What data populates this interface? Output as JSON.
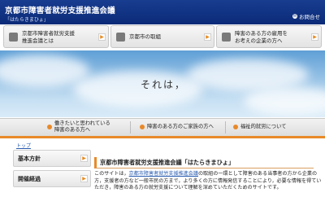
{
  "header": {
    "title": "京都市障害者就労支援推進会議",
    "subtitle": "「はたらきまひょ」",
    "contact": "お問合せ"
  },
  "topnav": [
    {
      "line1": "京都市障害者就労支援",
      "line2": "推進会議とは"
    },
    {
      "line1": "京都市の取組",
      "line2": ""
    },
    {
      "line1": "障害のある方の雇用を",
      "line2": "お考えの企業の方へ"
    }
  ],
  "hero": {
    "text": "それは，"
  },
  "subnav": [
    {
      "line1": "働きたいと思われている",
      "line2": "障害のある方へ"
    },
    {
      "line1": "障害のある方のご家族の方へ",
      "line2": ""
    },
    {
      "line1": "福祉的就労について",
      "line2": ""
    }
  ],
  "breadcrumb": "トップ",
  "sidebar": [
    {
      "label": "基本方針"
    },
    {
      "label": "開催経過"
    }
  ],
  "content": {
    "title": "京都市障害者就労支援推進会議「はたらきまひょ」",
    "intro_before": "このサイトは，",
    "intro_link": "京都市障害者就労支援推進会議",
    "intro_after": "の取組の一環として障害のある当事者の方から企業の方，支援者の方など一般市民の方まで，より多くの方に情報発信することにより，必要な情報を得ていただき，障害のある方の就労支援について理解を深めていただくためのサイトです。"
  },
  "colors": {
    "header": "#0b2b78",
    "accent": "#e8892a",
    "link": "#2a5db0"
  }
}
